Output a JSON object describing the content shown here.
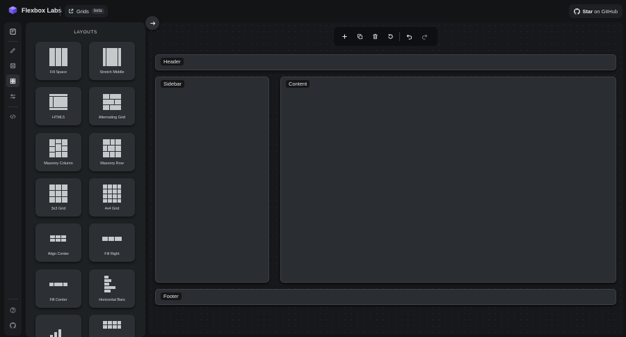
{
  "app": {
    "brand_name": "Flexbox Labs",
    "section_label": "Grids",
    "section_badge": "beta",
    "github_star": "Star",
    "github_rest": " on GitHub",
    "accent_color": "#8b6cf6"
  },
  "rail": {
    "items": [
      {
        "name": "layouts-icon",
        "active": false
      },
      {
        "name": "edit-icon",
        "active": false
      },
      {
        "name": "save-icon",
        "active": false
      },
      {
        "name": "grid-icon",
        "active": true
      },
      {
        "name": "sliders-icon",
        "active": false
      },
      {
        "name": "code-icon",
        "active": false
      },
      {
        "name": "help-icon",
        "active": false
      },
      {
        "name": "github-icon",
        "active": false
      }
    ]
  },
  "panel": {
    "title": "LAYOUTS",
    "cards": [
      {
        "label": "Fill Space",
        "icon": "fill-space-icon"
      },
      {
        "label": "Stretch Middle",
        "icon": "stretch-middle-icon"
      },
      {
        "label": "HTML5",
        "icon": "html5-layout-icon"
      },
      {
        "label": "Alternating Grid",
        "icon": "alternating-grid-icon"
      },
      {
        "label": "Masonry Column",
        "icon": "masonry-column-icon"
      },
      {
        "label": "Masonry Row",
        "icon": "masonry-row-icon"
      },
      {
        "label": "3x3 Grid",
        "icon": "grid-3x3-icon"
      },
      {
        "label": "4x4 Grid",
        "icon": "grid-4x4-icon"
      },
      {
        "label": "Align Center",
        "icon": "align-center-icon"
      },
      {
        "label": "Fill Right",
        "icon": "fill-right-icon"
      },
      {
        "label": "Fill Center",
        "icon": "fill-center-icon"
      },
      {
        "label": "Horizontal Bars",
        "icon": "horizontal-bars-icon"
      },
      {
        "label": "",
        "icon": "bar-chart-layout-icon"
      },
      {
        "label": "",
        "icon": "grid-layout-icon"
      }
    ]
  },
  "toolbar": {
    "buttons": [
      "add-icon",
      "duplicate-icon",
      "delete-icon",
      "reset-icon",
      "undo-icon",
      "redo-icon"
    ]
  },
  "canvas": {
    "header": "Header",
    "sidebar": "Sidebar",
    "content": "Content",
    "footer": "Footer"
  }
}
